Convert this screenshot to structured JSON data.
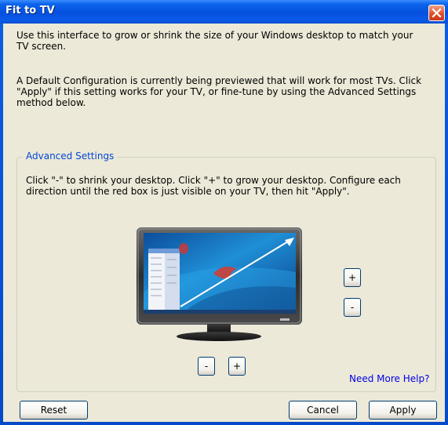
{
  "window": {
    "title": "Fit to TV",
    "close_icon": "close-x-icon"
  },
  "intro": {
    "paragraph1": "Use this interface to grow or shrink the size of your Windows desktop to match your TV screen.",
    "paragraph2": "A Default Configuration is currently being previewed that will work for most TVs. Click \"Apply\" if this setting works for your TV, or fine-tune by using the Advanced Settings method below."
  },
  "advanced": {
    "legend": "Advanced Settings",
    "instructions": "Click \"-\" to shrink  your desktop. Click \"+\" to grow your desktop. Configure each direction until the red box is just visible on your TV, then hit \"Apply\".",
    "tv_image": "tv-monitor-illustration",
    "right_plus": "+",
    "right_minus": "-",
    "bottom_minus": "-",
    "bottom_plus": "+",
    "help_link": "Need More Help?"
  },
  "footer": {
    "reset": "Reset",
    "cancel": "Cancel",
    "apply": "Apply"
  },
  "colors": {
    "titlebar": "#0551de",
    "client_bg": "#ece9d8",
    "legend_text": "#0046d5",
    "link": "#0000e6",
    "close_button": "#e2502a"
  }
}
